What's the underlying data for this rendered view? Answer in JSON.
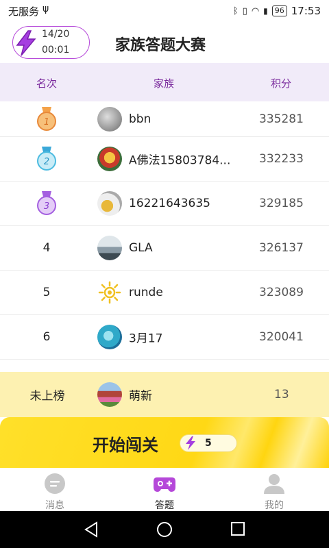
{
  "status_bar": {
    "carrier": "无服务",
    "battery": "96",
    "time": "17:53"
  },
  "header": {
    "energy_count": "14/20",
    "energy_timer": "00:01",
    "title": "家族答题大赛"
  },
  "columns": {
    "rank": "名次",
    "family": "家族",
    "score": "积分"
  },
  "leaderboard": [
    {
      "rank": "1",
      "name": "bbn",
      "score": "335281"
    },
    {
      "rank": "2",
      "name": "A佛法15803784...",
      "score": "332233"
    },
    {
      "rank": "3",
      "name": "16221643635",
      "score": "329185"
    },
    {
      "rank": "4",
      "name": "GLA",
      "score": "326137"
    },
    {
      "rank": "5",
      "name": "runde",
      "score": "323089"
    },
    {
      "rank": "6",
      "name": "3月17",
      "score": "320041"
    }
  ],
  "my_family": {
    "rank": "未上榜",
    "name": "萌新",
    "score": "13"
  },
  "start": {
    "label": "开始闯关",
    "energy_cost": "5"
  },
  "tabs": [
    {
      "label": "消息",
      "icon": "message-icon",
      "active": false
    },
    {
      "label": "答题",
      "icon": "gamepad-icon",
      "active": true
    },
    {
      "label": "我的",
      "icon": "user-icon",
      "active": false
    }
  ],
  "colors": {
    "accent_purple": "#b548d9",
    "header_bg": "#f1ebf9",
    "gold": "#ffd815",
    "my_row_bg": "#fdf1b1"
  }
}
